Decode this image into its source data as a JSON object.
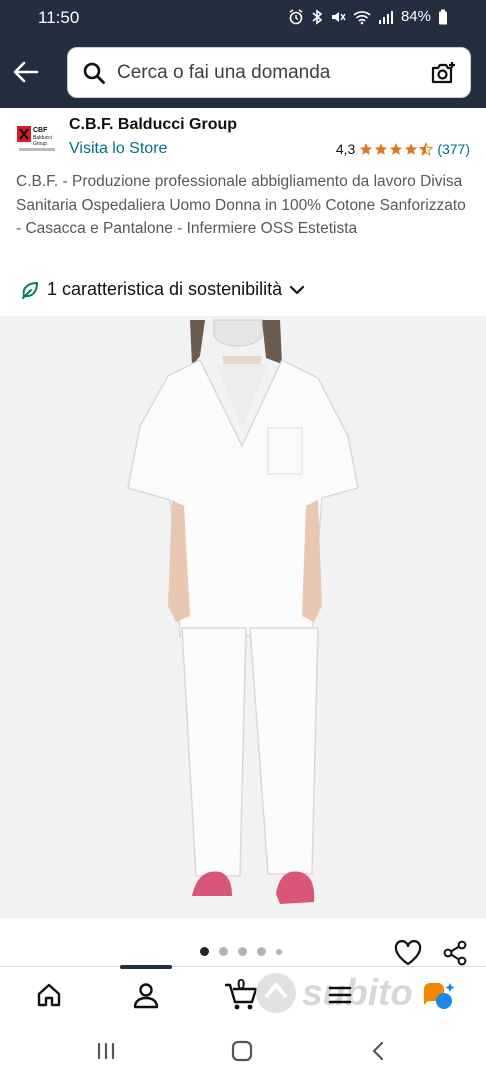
{
  "status_bar": {
    "time": "11:50",
    "battery": "84%",
    "icons": [
      "alarm-icon",
      "bluetooth-icon",
      "mute-icon",
      "wifi-icon",
      "signal-icon",
      "battery-icon"
    ]
  },
  "header": {
    "search_placeholder": "Cerca o fai una domanda",
    "icons": [
      "back-arrow-icon",
      "search-icon",
      "camera-icon"
    ]
  },
  "brand": {
    "name": "C.B.F. Balducci Group",
    "store_link": "Visita lo Store",
    "rating_value": "4,3",
    "rating_count": "(377)",
    "stars": 4.3,
    "logo_text": "CBF Balducci Group"
  },
  "product": {
    "title": "C.B.F. - Produzione professionale abbigliamento da lavoro Divisa Sanitaria Ospedaliera Uomo Donna in 100% Cotone Sanforizzato - Casacca e Pantalone - Infermiere OSS Estetista",
    "sustainability": "1 caratteristica di sostenibilità",
    "image_count": 5,
    "image_index": 1
  },
  "bottom_nav": {
    "cart_count": "0",
    "icons": [
      "home-icon",
      "account-icon",
      "cart-icon",
      "menu-icon",
      "rufus-icon"
    ],
    "watermark": "subito"
  },
  "colors": {
    "header_bg": "#232f3e",
    "link": "#007185",
    "star": "#de7921",
    "text_secondary": "#565959"
  }
}
